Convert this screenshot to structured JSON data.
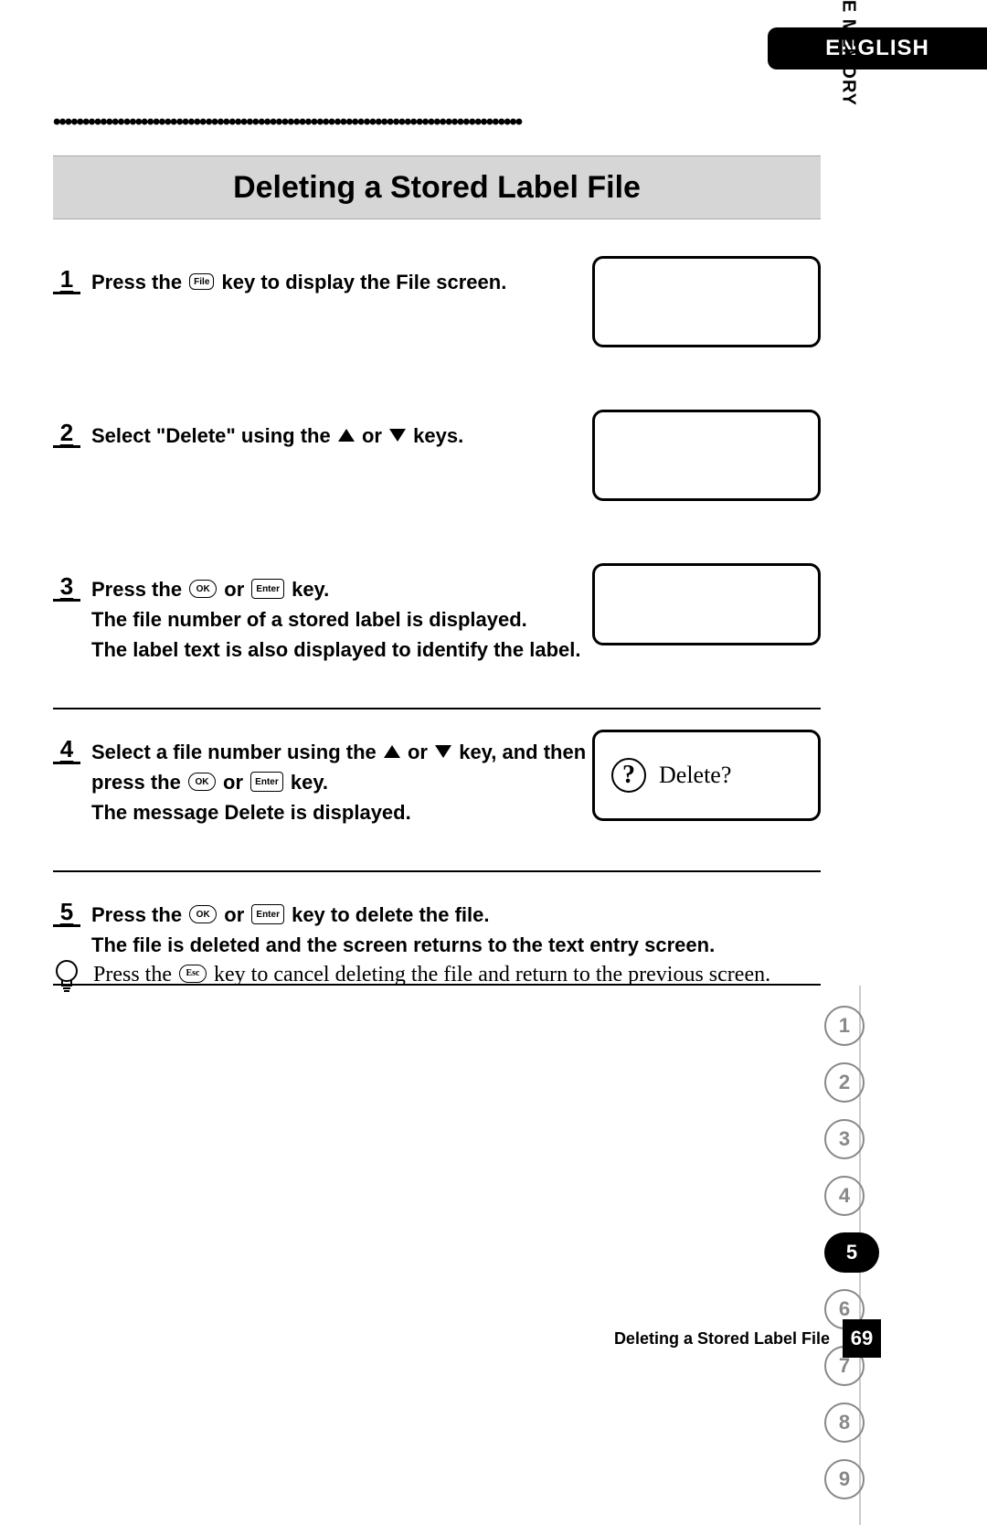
{
  "language": "ENGLISH",
  "chapter_marker": "z",
  "chapter_title": "USING THE FILE MEMORY",
  "page_title": "Deleting a Stored Label File",
  "keys": {
    "file": "File",
    "ok": "OK",
    "enter": "Enter",
    "esc": "Esc"
  },
  "steps": [
    {
      "n": "1",
      "pre1": "Press the ",
      "post1": " key to display the File screen."
    },
    {
      "n": "2",
      "pre1": "Select \"Delete\" using the ",
      "mid1": " or ",
      "post1": " keys."
    },
    {
      "n": "3",
      "pre1": "Press the ",
      "mid1": " or ",
      "post1": " key.",
      "line2": "The file number of a stored label is displayed.",
      "line3": "The label text is also displayed to identify the label."
    },
    {
      "n": "4",
      "pre1": "Select a file number using the ",
      "mid1": " or ",
      "post1": " key, and then ",
      "line2a": "press the ",
      "line2mid": " or ",
      "line2b": " key.",
      "line3": "The message Delete is displayed.",
      "dialog": "Delete?"
    },
    {
      "n": "5",
      "pre1": "Press the ",
      "mid1": " or ",
      "post1": " key to delete the file.",
      "line2": "The file is deleted and the screen returns to the text entry screen."
    }
  ],
  "tip": {
    "pre": "Press the ",
    "post": " key to cancel deleting the file and return to the previous screen."
  },
  "chapter_tabs": [
    "1",
    "2",
    "3",
    "4",
    "5",
    "6",
    "7",
    "8",
    "9"
  ],
  "active_chapter_index": 4,
  "footer_title": "Deleting a Stored Label File",
  "page_number": "69"
}
